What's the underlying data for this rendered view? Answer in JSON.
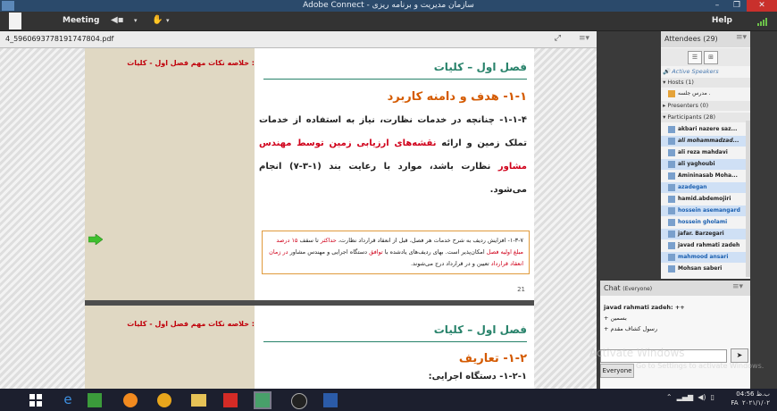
{
  "window": {
    "title": "Adobe Connect - سازمان مدیریت و برنامه ریزی",
    "buttons": [
      "–",
      "❐",
      "✕"
    ]
  },
  "menubar": {
    "meeting_label": "Meeting",
    "help_label": "Help"
  },
  "document": {
    "filename": "4_5960693778191747804.pdf",
    "fit_icon": "fit-width-icon",
    "pages": [
      {
        "sidebar_title": "خلاصه نکات مهم فصل اول - کلیات :",
        "header": "فصل اول – کلیات",
        "section_title": "۱-۱- هدف و دامنه کاربرد",
        "body_parts": [
          {
            "text": "۱-۱-۴- چنانچه در خدمات نظارت، نیاز به استفاده از خدمات تملک زمین و ارائه ",
            "highlight": false
          },
          {
            "text": "نقشه‌های ارزیابی زمین توسط مهندس مشاور",
            "highlight": true
          },
          {
            "text": " نظارت باشد، موارد با رعایت بند (۱-۳-۷) انجام می‌شود.",
            "highlight": false
          }
        ],
        "note_parts": [
          {
            "text": "۱-۳-۷- افزایش ردیف به شرح خدمات هر فصل، قبل از انعقاد قرارداد نظارت، ",
            "highlight": false
          },
          {
            "text": "حداکثر",
            "highlight": true
          },
          {
            "text": " تا سقف ",
            "highlight": false
          },
          {
            "text": "۱۵ درصد مبلغ اولیه فصل",
            "highlight": true
          },
          {
            "text": " امکان‌پذیر است. بهای ردیف‌های یادشده با ",
            "highlight": false
          },
          {
            "text": "توافق",
            "highlight": true
          },
          {
            "text": " دستگاه اجرایی و مهندس مشاور ",
            "highlight": false
          },
          {
            "text": "در زمان انعقاد قرارداد",
            "highlight": true
          },
          {
            "text": " تعیین و در قرارداد درج می‌شوند.",
            "highlight": false
          }
        ],
        "page_number": "21"
      },
      {
        "sidebar_title": "خلاصه نکات مهم فصل اول - کلیات :",
        "header": "فصل اول – کلیات",
        "section_title": "۱-۲- تعاریف",
        "subsection": "۱-۲-۱- دستگاه اجرایی:"
      }
    ]
  },
  "attendees": {
    "title": "Attendees",
    "count": "(29)",
    "active_speakers": "Active Speakers",
    "hosts_label": "Hosts (1)",
    "hosts": [
      "مدرس جلسه ."
    ],
    "presenters_label": "Presenters (0)",
    "participants_label": "Participants (28)",
    "participants": [
      {
        "name": "akbari nazere saz...",
        "style": "normal"
      },
      {
        "name": "ali mohammadzad...",
        "style": "italic"
      },
      {
        "name": "ali reza mahdavi",
        "style": "normal"
      },
      {
        "name": "ali yaghoubi",
        "style": "normal"
      },
      {
        "name": "Amininasab  Moha...",
        "style": "normal"
      },
      {
        "name": "azadegan",
        "style": "blue"
      },
      {
        "name": "hamid.abdemojiri",
        "style": "normal"
      },
      {
        "name": "hossein asemangard",
        "style": "blue"
      },
      {
        "name": "hossein gholami",
        "style": "blue"
      },
      {
        "name": "jafar. Barzegari",
        "style": "normal"
      },
      {
        "name": "javad rahmati zadeh",
        "style": "normal"
      },
      {
        "name": "mahmood ansari",
        "style": "blue"
      },
      {
        "name": "Mohsan saberi",
        "style": "normal"
      }
    ]
  },
  "chat": {
    "title": "Chat",
    "scope": "(Everyone)",
    "messages": [
      {
        "text": "javad rahmati zadeh: ++",
        "bold": true
      },
      {
        "text": "+ بسمین",
        "bold": false
      },
      {
        "text": "+ رسول کشاف مقدم",
        "bold": false
      }
    ],
    "recipient": "Everyone",
    "watermark": "Activate Windows",
    "watermark_sub": "Go to Settings to activate Windows."
  },
  "taskbar": {
    "time": "04:56 ب.ظ",
    "date": "۲۰۲۱/۱/۰۲",
    "lang": "FA"
  },
  "colors": {
    "accent_green": "#27826a",
    "section_orange": "#d45a00",
    "highlight_red": "#d0001a",
    "sidebar_beige": "#e0d8c3"
  }
}
